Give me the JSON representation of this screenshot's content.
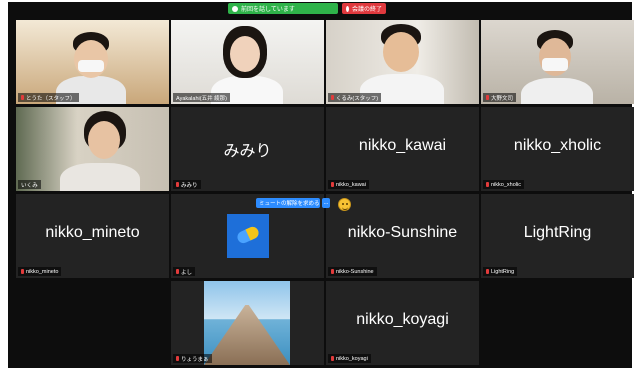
{
  "meeting": {
    "talking_label": "前回を話しています",
    "end_label": "会議の終了"
  },
  "participants": [
    {
      "label": "とうた（スタッフ）",
      "display": "",
      "type": "video"
    },
    {
      "label": "Ayakalahi(五井 綾那)",
      "display": "",
      "type": "video"
    },
    {
      "label": "くるみ(スタッフ)",
      "display": "",
      "type": "video"
    },
    {
      "label": "大野文司",
      "display": "",
      "type": "video"
    },
    {
      "label": "いくみ",
      "display": "",
      "type": "video"
    },
    {
      "label": "みみり",
      "display": "みみり",
      "type": "name"
    },
    {
      "label": "nikko_kawai",
      "display": "nikko_kawai",
      "type": "name"
    },
    {
      "label": "nikko_xholic",
      "display": "nikko_xholic",
      "type": "name"
    },
    {
      "label": "nikko_mineto",
      "display": "nikko_mineto",
      "type": "name"
    },
    {
      "label": "よし",
      "display": "",
      "type": "avatar"
    },
    {
      "label": "nikko-Sunshine",
      "display": "nikko-Sunshine",
      "type": "name"
    },
    {
      "label": "LightRing",
      "display": "LightRing",
      "type": "name"
    },
    {
      "label": "りょうまぁ",
      "display": "",
      "type": "image"
    },
    {
      "label": "nikko_koyagi",
      "display": "nikko_koyagi",
      "type": "name"
    }
  ],
  "hover_menu": {
    "mute_label": "ミュートの解除を求める",
    "more_label": "..."
  },
  "colors": {
    "background": "#0d0d0d",
    "tile": "#232323",
    "active_border": "#d4e052",
    "accent_blue": "#2d8cff",
    "talk_green": "#2fb34a",
    "end_red": "#e0393e",
    "mic_muted": "#e23b3b"
  },
  "icons": {
    "mic_muted": "mic-muted-icon",
    "reaction": "smile-emoji-icon"
  }
}
